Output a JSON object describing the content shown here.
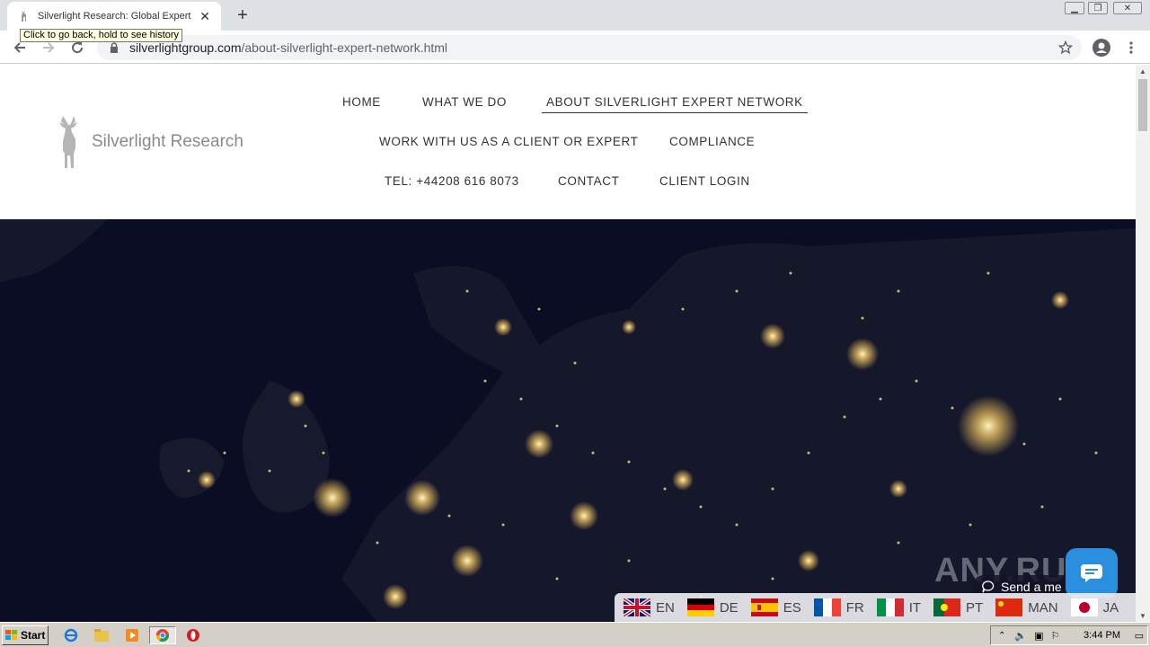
{
  "browser": {
    "tab_title": "Silverlight Research: Global Expert N",
    "tooltip": "Click to go back, hold to see history",
    "url_host": "silverlightgroup.com",
    "url_path": "/about-silverlight-expert-network.html"
  },
  "site": {
    "logo_text": "Silverlight Research",
    "nav": {
      "home": "HOME",
      "what_we_do": "WHAT WE DO",
      "about": "ABOUT SILVERLIGHT EXPERT NETWORK",
      "work_with_us": "WORK WITH US AS A CLIENT OR EXPERT",
      "compliance": "COMPLIANCE",
      "tel": "TEL: +44208 616 8073",
      "contact": "CONTACT",
      "client_login": "CLIENT LOGIN"
    },
    "chat_prompt": "Send a me",
    "watermark": "ANY.RUN",
    "languages": [
      {
        "code": "EN"
      },
      {
        "code": "DE"
      },
      {
        "code": "ES"
      },
      {
        "code": "FR"
      },
      {
        "code": "IT"
      },
      {
        "code": "PT"
      },
      {
        "code": "MAN"
      },
      {
        "code": "JA"
      }
    ]
  },
  "taskbar": {
    "start": "Start",
    "clock": "3:44 PM"
  },
  "colors": {
    "hero_bg": "#0a0d24",
    "chat_button": "#2b8fe0",
    "city_lights": "#f5d27a"
  }
}
